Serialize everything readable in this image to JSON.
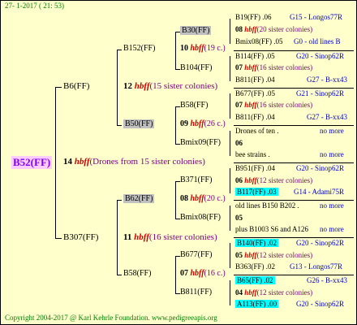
{
  "header": {
    "date": "27-  1-2017  ( 21: 53)"
  },
  "footer": {
    "copyright": "Copyright 2004-2017 @ Karl Kehrle Foundation.   www.pedigreeapis.org"
  },
  "root": {
    "label": "B52(FF)",
    "gen_num": "14",
    "hbff": "hbff",
    "note": "(Drones from 15 sister colonies)"
  },
  "gen1": {
    "upper": {
      "label": "B6(FF)",
      "num": "12",
      "hbff": "hbff",
      "note": "(15 sister colonies)"
    },
    "lower": {
      "label": "B307(FF)",
      "num": "11",
      "hbff": "hbff",
      "note": "(16 sister colonies)"
    }
  },
  "gen2": {
    "b152": {
      "label": "B152(FF)",
      "num": "10",
      "hbff": "hbff",
      "note": "(19 c.)"
    },
    "b50": {
      "label": "B50(FF)",
      "num": "09",
      "hbff": "hbff",
      "note": "(26 c.)"
    },
    "b62": {
      "label": "B62(FF)",
      "num": "08",
      "hbff": "hbff",
      "note": "(20 c.)"
    },
    "b58": {
      "label": "B58(FF)",
      "num": "07",
      "hbff": "hbff",
      "note": "(16 c.)"
    }
  },
  "gen3": {
    "b30": "B30(FF)",
    "b104": "B104(FF)",
    "b58": "B58(FF)",
    "bmix09": "Bmix09(FF)",
    "b371": "B371(FF)",
    "bmix08": "Bmix08(FF)",
    "b677": "B677(FF)",
    "b811": "B811(FF)"
  },
  "gen4": [
    {
      "left": "B19(FF) .06",
      "right": "G15 - Longos77R"
    },
    {
      "num": "08",
      "hbff": "hbff",
      "note": "(20 sister colonies)"
    },
    {
      "left": "Bmix08(FF) .05",
      "right": "G0 - old lines B"
    },
    {
      "left": "B114(FF) .05",
      "right": "G20 - Sinop62R"
    },
    {
      "num": "07",
      "hbff": "hbff",
      "note": "(16 sister colonies)"
    },
    {
      "left": "B811(FF) .04",
      "right": "G27 - B-xx43"
    },
    {
      "left": "B677(FF) .05",
      "right": "G21 - Sinop62R"
    },
    {
      "num": "07",
      "hbff": "hbff",
      "note": "(16 sister colonies)"
    },
    {
      "left": "B811(FF) .04",
      "right": "G27 - B-xx43"
    },
    {
      "left": "Drones of ten .",
      "right": "no more"
    },
    {
      "num": "06"
    },
    {
      "left": "bee strains .",
      "right": "no more"
    },
    {
      "left": "B951(FF) .04",
      "right": "G20 - Sinop62R"
    },
    {
      "num": "06",
      "hbff": "hbff",
      "note": "(12 sister colonies)"
    },
    {
      "left": "B117(FF) .03",
      "right": "G14 - Adami75R"
    },
    {
      "left": "old lines B150 B202 .",
      "right": "no more"
    },
    {
      "num": "05"
    },
    {
      "left": "plus B1003 S6 and A126",
      "right": "no more"
    },
    {
      "left": "B140(FF) .02",
      "right": "G20 - Sinop62R"
    },
    {
      "num": "05",
      "hbff": "hbff",
      "note": "(12 sister colonies)"
    },
    {
      "left": "B363(FF) .02",
      "right": "G13 - Longos77R"
    },
    {
      "left": "B65(FF) .02",
      "right": "G26 - B-xx43"
    },
    {
      "num": "04",
      "hbff": "hbff",
      "note": "(12 sister colonies)"
    },
    {
      "left": "A113(FF) .00",
      "right": "G20 - Sinop62R"
    }
  ]
}
